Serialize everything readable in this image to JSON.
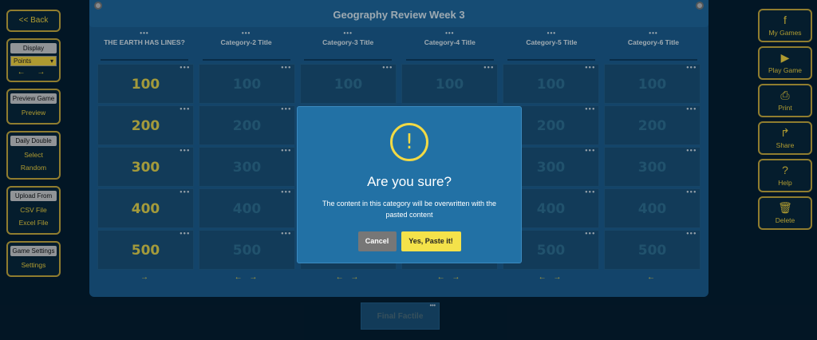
{
  "left_panel": {
    "back_label": "<< Back",
    "display": {
      "title": "Display",
      "selected": "Points",
      "arrows": "← →"
    },
    "preview": {
      "title": "Preview Game",
      "item": "Preview"
    },
    "daily_double": {
      "title": "Daily Double",
      "items": [
        "Select",
        "Random"
      ]
    },
    "upload": {
      "title": "Upload From",
      "items": [
        "CSV File",
        "Excel File"
      ]
    },
    "game_settings": {
      "title": "Game Settings",
      "item": "Settings"
    }
  },
  "right_panel": {
    "buttons": [
      {
        "icon": "facebook-icon",
        "glyph": "f",
        "label": "My Games"
      },
      {
        "icon": "play-icon",
        "glyph": "▶",
        "label": "Play Game"
      },
      {
        "icon": "print-icon",
        "glyph": "⎙",
        "label": "Print"
      },
      {
        "icon": "share-icon",
        "glyph": "↱",
        "label": "Share"
      },
      {
        "icon": "help-icon",
        "glyph": "?",
        "label": "Help"
      },
      {
        "icon": "trash-icon",
        "glyph": "🗑",
        "label": "Delete"
      }
    ]
  },
  "board": {
    "title": "Geography Review Week 3",
    "dots": "•••",
    "categories": [
      "THE EARTH HAS LINES?",
      "Category-2 Title",
      "Category-3 Title",
      "Category-4 Title",
      "Category-5 Title",
      "Category-6 Title"
    ],
    "points": [
      "100",
      "200",
      "300",
      "400",
      "500"
    ],
    "moves": [
      "→",
      "← →",
      "← →",
      "← →",
      "← →",
      "←"
    ],
    "final_label": "Final Factile"
  },
  "dialog": {
    "icon": "!",
    "title": "Are you sure?",
    "message": "The content in this category will be overwritten with the pasted content",
    "cancel_label": "Cancel",
    "confirm_label": "Yes, Paste it!"
  },
  "colors": {
    "background": "#041b2b",
    "board": "#1b5b8b",
    "accent_yellow": "#f2d23c",
    "dialog": "#2271a5"
  }
}
